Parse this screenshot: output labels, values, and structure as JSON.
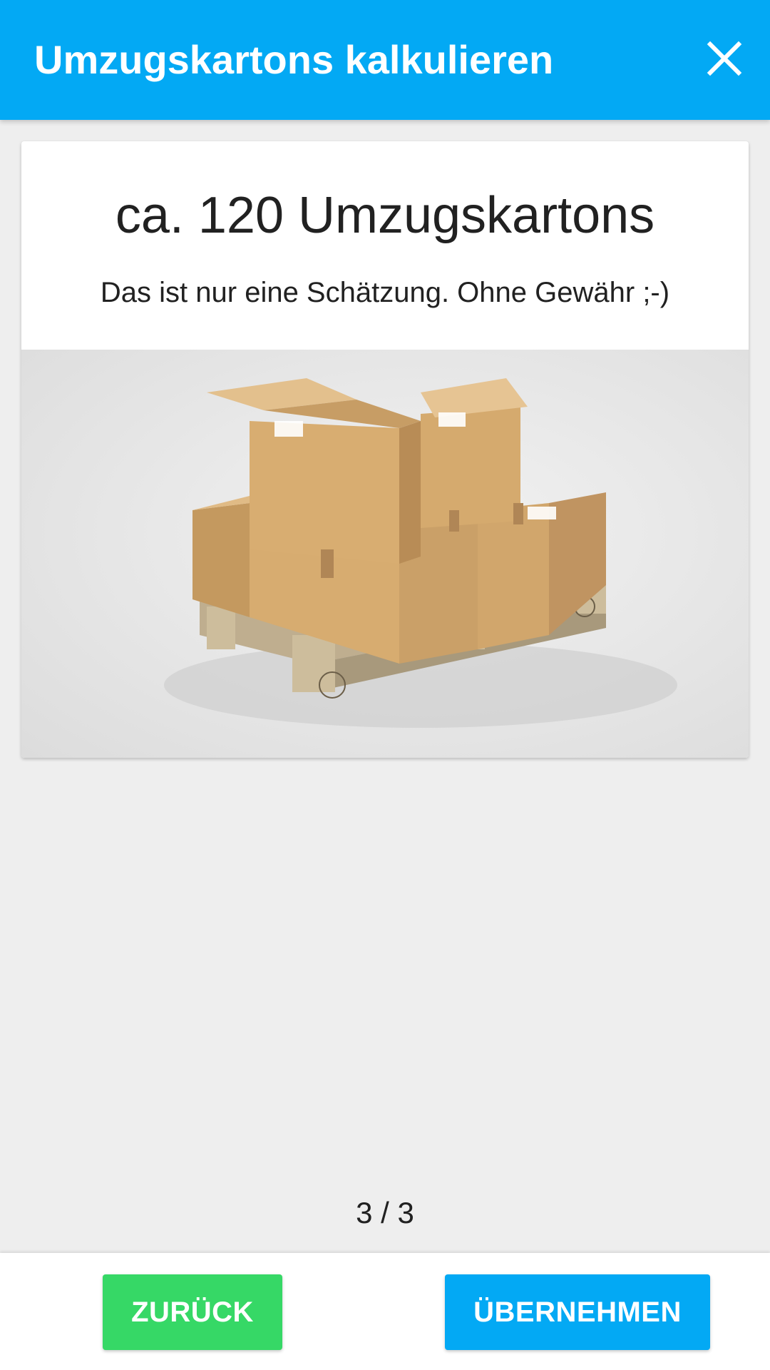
{
  "appbar": {
    "title": "Umzugskartons kalkulieren",
    "close_icon": "close-icon"
  },
  "result": {
    "title": "ca. 120 Umzugskartons",
    "note": "Das ist nur eine Schätzung. Ohne Gewähr ;-)",
    "image": "moving-boxes-on-pallet-photo"
  },
  "pager": {
    "text": "3 / 3"
  },
  "actions": {
    "back_label": "ZURÜCK",
    "accept_label": "ÜBERNEHMEN"
  },
  "colors": {
    "primary": "#03a9f4",
    "success": "#36d866",
    "background": "#eeeeee"
  }
}
